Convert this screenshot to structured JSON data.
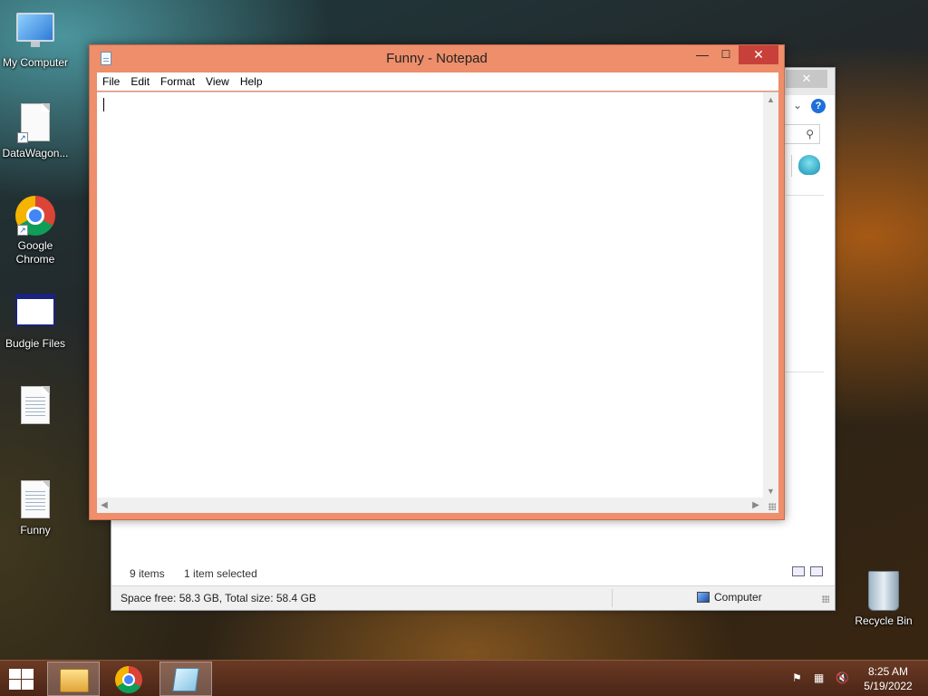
{
  "desktop": {
    "icons": [
      {
        "label": "My Computer"
      },
      {
        "label": "DataWagon..."
      },
      {
        "label": "Google Chrome"
      },
      {
        "label": "Budgie Files"
      },
      {
        "label": ""
      },
      {
        "label": "Funny"
      },
      {
        "label": "Recycle Bin"
      }
    ]
  },
  "notepad": {
    "title": "Funny - Notepad",
    "menu": [
      "File",
      "Edit",
      "Format",
      "View",
      "Help"
    ],
    "content": "",
    "controls": {
      "minimize": "—",
      "maximize": "☐",
      "close": "✕"
    }
  },
  "explorer": {
    "close": "✕",
    "help": "?",
    "status_items": "9 items",
    "status_selected": "1 item selected",
    "space": "Space free: 58.3 GB, Total size: 58.4 GB",
    "location": "Computer"
  },
  "taskbar": {
    "time": "8:25 AM",
    "date": "5/19/2022",
    "apps": [
      "file-explorer",
      "google-chrome",
      "notepad"
    ],
    "active_app": "notepad"
  },
  "colors": {
    "notepad_frame": "#ee8e6b",
    "close_button": "#c7413a",
    "taskbar": "#5a2e1c"
  }
}
